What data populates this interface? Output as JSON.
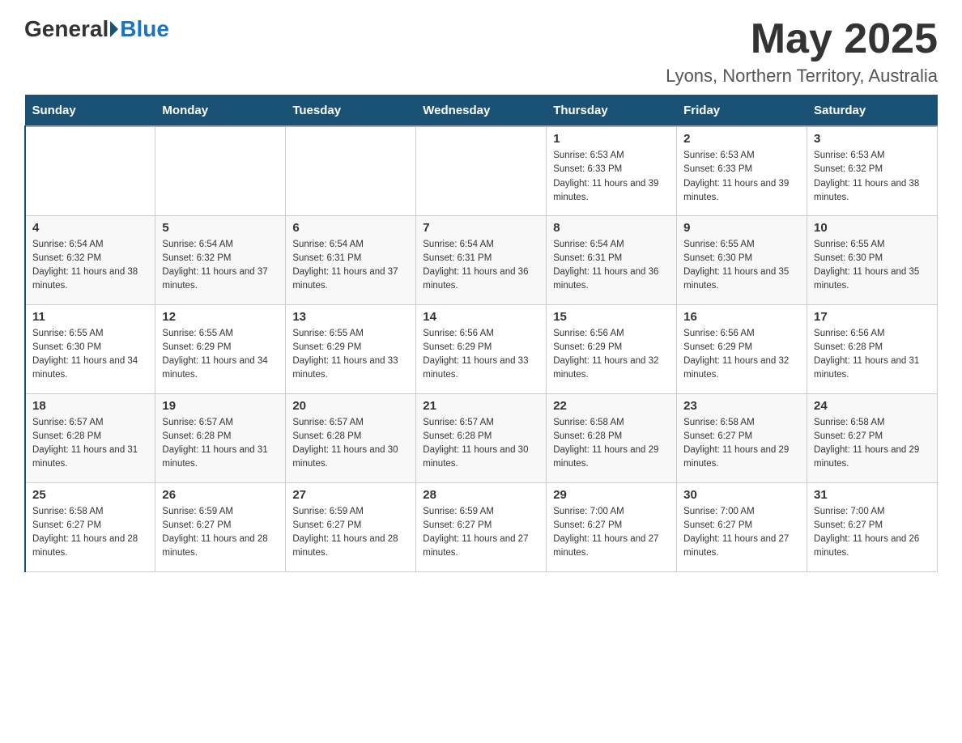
{
  "header": {
    "logo_general": "General",
    "logo_blue": "Blue",
    "main_title": "May 2025",
    "subtitle": "Lyons, Northern Territory, Australia"
  },
  "days_of_week": [
    "Sunday",
    "Monday",
    "Tuesday",
    "Wednesday",
    "Thursday",
    "Friday",
    "Saturday"
  ],
  "weeks": [
    [
      {
        "day": "",
        "info": ""
      },
      {
        "day": "",
        "info": ""
      },
      {
        "day": "",
        "info": ""
      },
      {
        "day": "",
        "info": ""
      },
      {
        "day": "1",
        "info": "Sunrise: 6:53 AM\nSunset: 6:33 PM\nDaylight: 11 hours and 39 minutes."
      },
      {
        "day": "2",
        "info": "Sunrise: 6:53 AM\nSunset: 6:33 PM\nDaylight: 11 hours and 39 minutes."
      },
      {
        "day": "3",
        "info": "Sunrise: 6:53 AM\nSunset: 6:32 PM\nDaylight: 11 hours and 38 minutes."
      }
    ],
    [
      {
        "day": "4",
        "info": "Sunrise: 6:54 AM\nSunset: 6:32 PM\nDaylight: 11 hours and 38 minutes."
      },
      {
        "day": "5",
        "info": "Sunrise: 6:54 AM\nSunset: 6:32 PM\nDaylight: 11 hours and 37 minutes."
      },
      {
        "day": "6",
        "info": "Sunrise: 6:54 AM\nSunset: 6:31 PM\nDaylight: 11 hours and 37 minutes."
      },
      {
        "day": "7",
        "info": "Sunrise: 6:54 AM\nSunset: 6:31 PM\nDaylight: 11 hours and 36 minutes."
      },
      {
        "day": "8",
        "info": "Sunrise: 6:54 AM\nSunset: 6:31 PM\nDaylight: 11 hours and 36 minutes."
      },
      {
        "day": "9",
        "info": "Sunrise: 6:55 AM\nSunset: 6:30 PM\nDaylight: 11 hours and 35 minutes."
      },
      {
        "day": "10",
        "info": "Sunrise: 6:55 AM\nSunset: 6:30 PM\nDaylight: 11 hours and 35 minutes."
      }
    ],
    [
      {
        "day": "11",
        "info": "Sunrise: 6:55 AM\nSunset: 6:30 PM\nDaylight: 11 hours and 34 minutes."
      },
      {
        "day": "12",
        "info": "Sunrise: 6:55 AM\nSunset: 6:29 PM\nDaylight: 11 hours and 34 minutes."
      },
      {
        "day": "13",
        "info": "Sunrise: 6:55 AM\nSunset: 6:29 PM\nDaylight: 11 hours and 33 minutes."
      },
      {
        "day": "14",
        "info": "Sunrise: 6:56 AM\nSunset: 6:29 PM\nDaylight: 11 hours and 33 minutes."
      },
      {
        "day": "15",
        "info": "Sunrise: 6:56 AM\nSunset: 6:29 PM\nDaylight: 11 hours and 32 minutes."
      },
      {
        "day": "16",
        "info": "Sunrise: 6:56 AM\nSunset: 6:29 PM\nDaylight: 11 hours and 32 minutes."
      },
      {
        "day": "17",
        "info": "Sunrise: 6:56 AM\nSunset: 6:28 PM\nDaylight: 11 hours and 31 minutes."
      }
    ],
    [
      {
        "day": "18",
        "info": "Sunrise: 6:57 AM\nSunset: 6:28 PM\nDaylight: 11 hours and 31 minutes."
      },
      {
        "day": "19",
        "info": "Sunrise: 6:57 AM\nSunset: 6:28 PM\nDaylight: 11 hours and 31 minutes."
      },
      {
        "day": "20",
        "info": "Sunrise: 6:57 AM\nSunset: 6:28 PM\nDaylight: 11 hours and 30 minutes."
      },
      {
        "day": "21",
        "info": "Sunrise: 6:57 AM\nSunset: 6:28 PM\nDaylight: 11 hours and 30 minutes."
      },
      {
        "day": "22",
        "info": "Sunrise: 6:58 AM\nSunset: 6:28 PM\nDaylight: 11 hours and 29 minutes."
      },
      {
        "day": "23",
        "info": "Sunrise: 6:58 AM\nSunset: 6:27 PM\nDaylight: 11 hours and 29 minutes."
      },
      {
        "day": "24",
        "info": "Sunrise: 6:58 AM\nSunset: 6:27 PM\nDaylight: 11 hours and 29 minutes."
      }
    ],
    [
      {
        "day": "25",
        "info": "Sunrise: 6:58 AM\nSunset: 6:27 PM\nDaylight: 11 hours and 28 minutes."
      },
      {
        "day": "26",
        "info": "Sunrise: 6:59 AM\nSunset: 6:27 PM\nDaylight: 11 hours and 28 minutes."
      },
      {
        "day": "27",
        "info": "Sunrise: 6:59 AM\nSunset: 6:27 PM\nDaylight: 11 hours and 28 minutes."
      },
      {
        "day": "28",
        "info": "Sunrise: 6:59 AM\nSunset: 6:27 PM\nDaylight: 11 hours and 27 minutes."
      },
      {
        "day": "29",
        "info": "Sunrise: 7:00 AM\nSunset: 6:27 PM\nDaylight: 11 hours and 27 minutes."
      },
      {
        "day": "30",
        "info": "Sunrise: 7:00 AM\nSunset: 6:27 PM\nDaylight: 11 hours and 27 minutes."
      },
      {
        "day": "31",
        "info": "Sunrise: 7:00 AM\nSunset: 6:27 PM\nDaylight: 11 hours and 26 minutes."
      }
    ]
  ]
}
